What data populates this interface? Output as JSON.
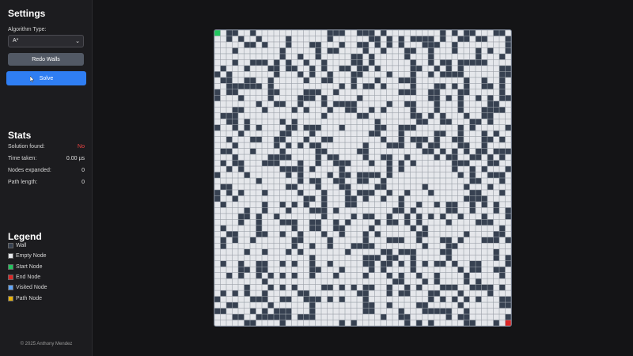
{
  "settings": {
    "title": "Settings",
    "algorithm_label": "Algorithm Type:",
    "algorithm_selected": "A*",
    "redo_walls_label": "Redo Walls",
    "solve_label": "Solve"
  },
  "stats": {
    "title": "Stats",
    "rows": [
      {
        "label": "Solution found:",
        "value": "No"
      },
      {
        "label": "Time taken:",
        "value": "0.00 µs"
      },
      {
        "label": "Nodes expanded:",
        "value": "0"
      },
      {
        "label": "Path length:",
        "value": "0"
      }
    ]
  },
  "legend": {
    "title": "Legend",
    "items": [
      {
        "label": "Wall",
        "color": "#374151"
      },
      {
        "label": "Empty Node",
        "color": "#e5e7eb"
      },
      {
        "label": "Start Node",
        "color": "#22c55e"
      },
      {
        "label": "End Node",
        "color": "#dc2626"
      },
      {
        "label": "Visited Node",
        "color": "#60a5fa"
      },
      {
        "label": "Path Node",
        "color": "#eab308"
      }
    ]
  },
  "footer": "© 2025 Anthony Mendez",
  "grid": {
    "rows": 50,
    "cols": 50,
    "wall_color": "#374151",
    "empty_color": "#e5e7eb",
    "start_color": "#22c55e",
    "end_color": "#dc2626",
    "start_cell": [
      0,
      0
    ],
    "end_cell": [
      49,
      49
    ],
    "wall_density": 0.3
  }
}
